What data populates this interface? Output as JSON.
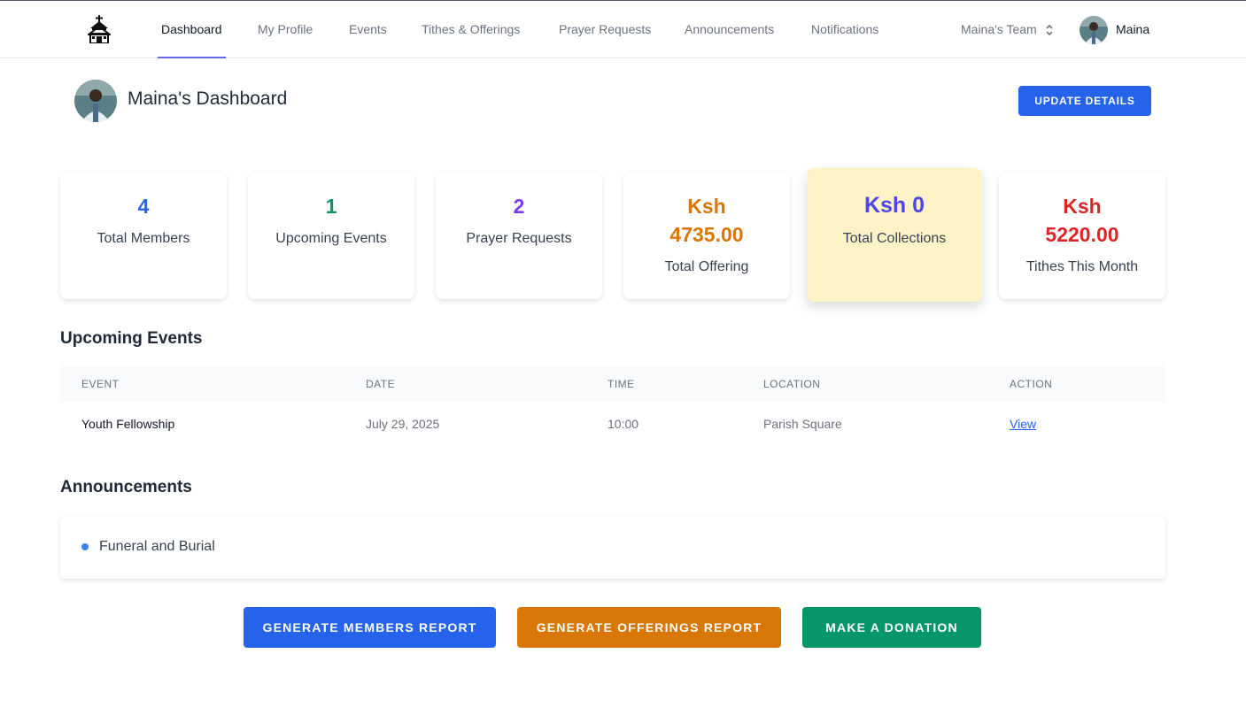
{
  "nav": {
    "items": [
      {
        "label": "Dashboard",
        "active": true
      },
      {
        "label": "My Profile",
        "active": false
      },
      {
        "label": "Events",
        "active": false
      },
      {
        "label": "Tithes & Offerings",
        "active": false
      },
      {
        "label": "Prayer Requests",
        "active": false
      },
      {
        "label": "Announcements",
        "active": false
      },
      {
        "label": "Notifications",
        "active": false
      }
    ],
    "team": "Maina's Team",
    "user": "Maina",
    "logo_icon": "church-icon",
    "accent": "#6366f1"
  },
  "header": {
    "title": "Maina's Dashboard",
    "update_button": "UPDATE DETAILS"
  },
  "stats": [
    {
      "value": "4",
      "label": "Total Members",
      "color": "#2563eb"
    },
    {
      "value": "1",
      "label": "Upcoming Events",
      "color": "#059669"
    },
    {
      "value": "2",
      "label": "Prayer Requests",
      "color": "#7c3aed"
    },
    {
      "value_line1": "Ksh",
      "value_line2": "4735.00",
      "label": "Total Offering",
      "color": "#d97706"
    },
    {
      "value": "Ksh 0",
      "label": "Total Collections",
      "color": "#4f46e5",
      "background": "#fef3c7"
    },
    {
      "value_line1": "Ksh",
      "value_line2": "5220.00",
      "label": "Tithes This Month",
      "color": "#dc2626"
    }
  ],
  "events": {
    "title": "Upcoming Events",
    "columns": [
      "EVENT",
      "DATE",
      "TIME",
      "LOCATION",
      "ACTION"
    ],
    "rows": [
      {
        "event": "Youth Fellowship",
        "date": "July 29, 2025",
        "time": "10:00",
        "location": "Parish Square",
        "action": "View"
      }
    ]
  },
  "announcements": {
    "title": "Announcements",
    "items": [
      "Funeral and Burial"
    ]
  },
  "actions": [
    {
      "label": "GENERATE MEMBERS REPORT",
      "color": "#2563eb"
    },
    {
      "label": "GENERATE OFFERINGS REPORT",
      "color": "#d97706"
    },
    {
      "label": "MAKE A DONATION",
      "color": "#059669"
    }
  ]
}
